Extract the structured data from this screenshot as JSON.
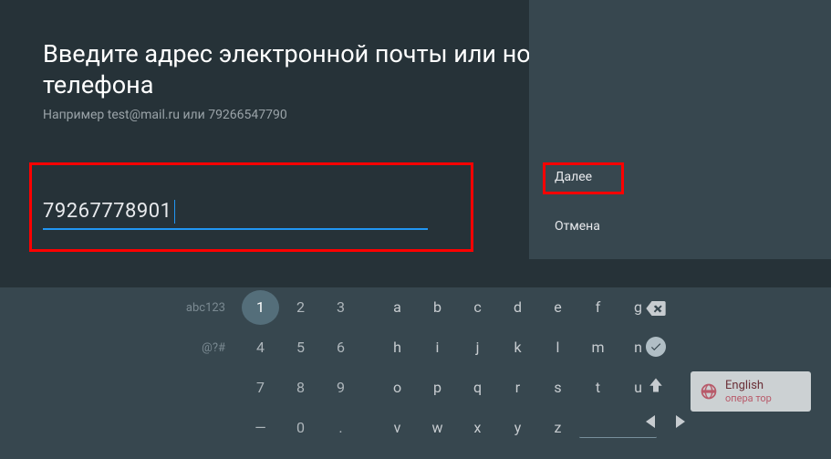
{
  "header": {
    "title": "Введите адрес электронной почты или номер мобильного телефона",
    "hint": "Например test@mail.ru или 79266547790"
  },
  "input": {
    "value": "79267778901"
  },
  "actions": {
    "next": "Далее",
    "cancel": "Отмена"
  },
  "keyboard": {
    "row_labels": [
      "abc123",
      "@?#",
      "",
      ""
    ],
    "rows": [
      {
        "nums": [
          "1",
          "2",
          "3"
        ],
        "letters": [
          "a",
          "b",
          "c",
          "d",
          "e",
          "f",
          "g"
        ]
      },
      {
        "nums": [
          "4",
          "5",
          "6"
        ],
        "letters": [
          "h",
          "i",
          "j",
          "k",
          "l",
          "m",
          "n"
        ]
      },
      {
        "nums": [
          "7",
          "8",
          "9"
        ],
        "letters": [
          "o",
          "p",
          "q",
          "r",
          "s",
          "t",
          "u"
        ]
      },
      {
        "nums": [
          "—",
          "0",
          "."
        ],
        "letters": [
          "v",
          "w",
          "x",
          "y",
          "z",
          "",
          ""
        ]
      }
    ],
    "active_key": "1"
  },
  "language": {
    "label": "English",
    "sublabel": "опера тор"
  }
}
